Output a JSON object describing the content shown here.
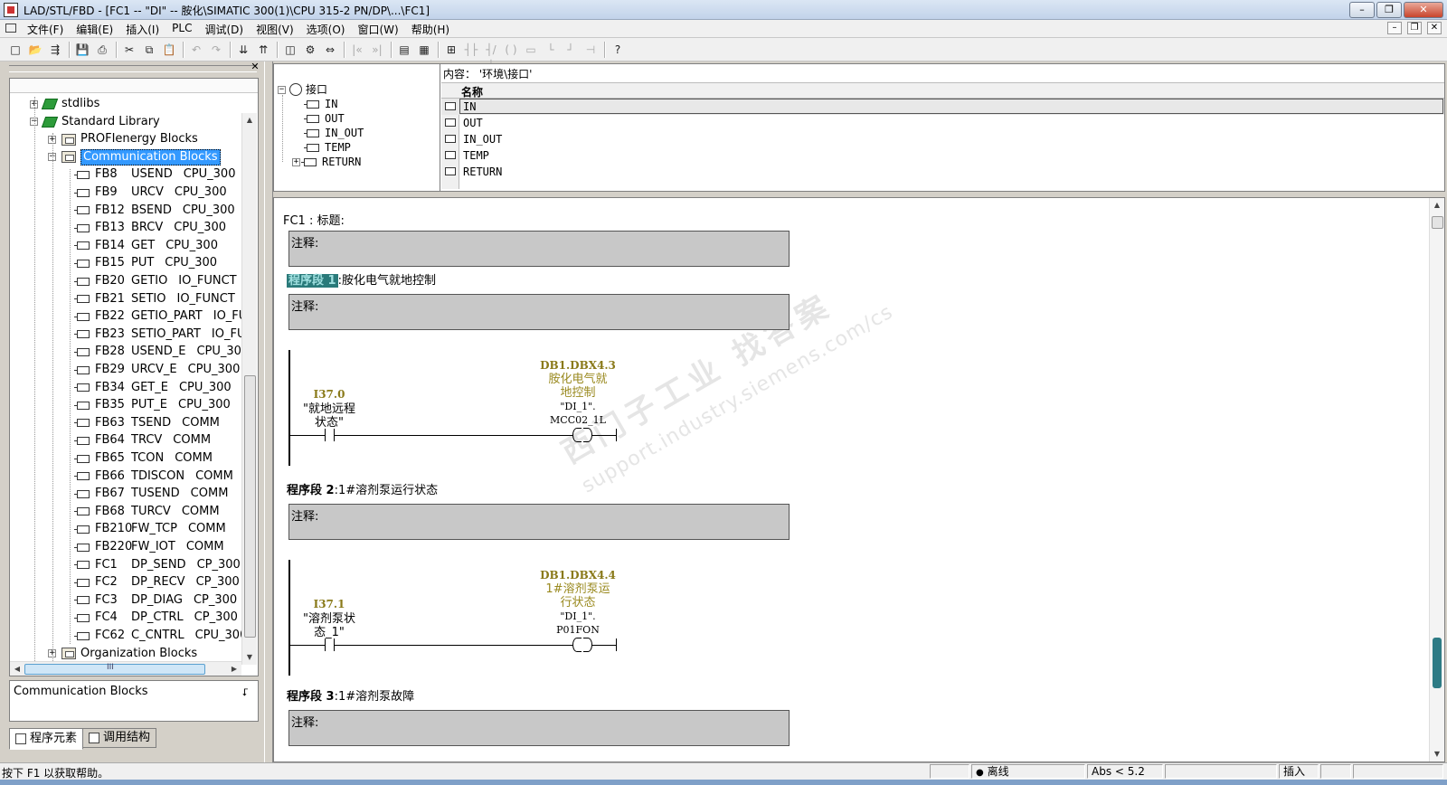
{
  "window": {
    "title": "LAD/STL/FBD  - [FC1 -- \"DI\" -- 胺化\\SIMATIC 300(1)\\CPU 315-2 PN/DP\\...\\FC1]",
    "buttons": {
      "minimize": "–",
      "restore": "❐",
      "close": "✕"
    }
  },
  "menu": {
    "items": [
      "文件(F)",
      "编辑(E)",
      "插入(I)",
      "PLC",
      "调试(D)",
      "视图(V)",
      "选项(O)",
      "窗口(W)",
      "帮助(H)"
    ],
    "mdi": {
      "minimize": "–",
      "restore": "❐",
      "close": "✕"
    }
  },
  "toolbar": {
    "icons": [
      "new-icon",
      "open-icon",
      "accessible-nodes-icon",
      "save-icon",
      "print-icon",
      "cut-icon",
      "copy-icon",
      "paste-icon",
      "undo-icon",
      "redo-icon",
      "download-icon",
      "upload-icon",
      "monitor-icon",
      "settings-icon",
      "compare-icon",
      "prev-icon",
      "next-icon",
      "overview-icon",
      "details-icon",
      "network-icon",
      "contact-no-icon",
      "contact-nc-icon",
      "coil-icon",
      "box-icon",
      "branch-open-icon",
      "branch-close-icon",
      "connect-icon",
      "help-cursor-icon"
    ]
  },
  "library_tree": {
    "nodes": [
      {
        "label": "stdlibs",
        "type": "library",
        "expander": "+"
      },
      {
        "label": "Standard Library",
        "type": "library",
        "expander": "−"
      },
      {
        "label": "PROFIenergy Blocks",
        "type": "folder",
        "expander": "+"
      },
      {
        "label": "Communication Blocks",
        "type": "folder",
        "expander": "−",
        "selected": true
      }
    ],
    "blocks": [
      {
        "id": "FB8",
        "name": "USEND",
        "family": "CPU_300"
      },
      {
        "id": "FB9",
        "name": "URCV",
        "family": "CPU_300"
      },
      {
        "id": "FB12",
        "name": "BSEND",
        "family": "CPU_300"
      },
      {
        "id": "FB13",
        "name": "BRCV",
        "family": "CPU_300"
      },
      {
        "id": "FB14",
        "name": "GET",
        "family": "CPU_300"
      },
      {
        "id": "FB15",
        "name": "PUT",
        "family": "CPU_300"
      },
      {
        "id": "FB20",
        "name": "GETIO",
        "family": "IO_FUNCT"
      },
      {
        "id": "FB21",
        "name": "SETIO",
        "family": "IO_FUNCT"
      },
      {
        "id": "FB22",
        "name": "GETIO_PART",
        "family": "IO_FU"
      },
      {
        "id": "FB23",
        "name": "SETIO_PART",
        "family": "IO_FU"
      },
      {
        "id": "FB28",
        "name": "USEND_E",
        "family": "CPU_300"
      },
      {
        "id": "FB29",
        "name": "URCV_E",
        "family": "CPU_300"
      },
      {
        "id": "FB34",
        "name": "GET_E",
        "family": "CPU_300"
      },
      {
        "id": "FB35",
        "name": "PUT_E",
        "family": "CPU_300"
      },
      {
        "id": "FB63",
        "name": "TSEND",
        "family": "COMM"
      },
      {
        "id": "FB64",
        "name": "TRCV",
        "family": "COMM"
      },
      {
        "id": "FB65",
        "name": "TCON",
        "family": "COMM"
      },
      {
        "id": "FB66",
        "name": "TDISCON",
        "family": "COMM"
      },
      {
        "id": "FB67",
        "name": "TUSEND",
        "family": "COMM"
      },
      {
        "id": "FB68",
        "name": "TURCV",
        "family": "COMM"
      },
      {
        "id": "FB210",
        "name": "FW_TCP",
        "family": "COMM"
      },
      {
        "id": "FB220",
        "name": "FW_IOT",
        "family": "COMM"
      },
      {
        "id": "FC1",
        "name": "DP_SEND",
        "family": "CP_300"
      },
      {
        "id": "FC2",
        "name": "DP_RECV",
        "family": "CP_300"
      },
      {
        "id": "FC3",
        "name": "DP_DIAG",
        "family": "CP_300"
      },
      {
        "id": "FC4",
        "name": "DP_CTRL",
        "family": "CP_300"
      },
      {
        "id": "FC62",
        "name": "C_CNTRL",
        "family": "CPU_300"
      }
    ],
    "trailing": {
      "label": "Organization Blocks",
      "expander": "+"
    },
    "hscroll_glyph": "III"
  },
  "info_box": {
    "text": "Communication Blocks",
    "button": "⮦"
  },
  "left_tabs": [
    {
      "label": "程序元素",
      "active": true
    },
    {
      "label": "调用结构",
      "active": false
    }
  ],
  "interface": {
    "root": "接口",
    "items": [
      {
        "label": "IN",
        "expander": ""
      },
      {
        "label": "OUT",
        "expander": ""
      },
      {
        "label": "IN_OUT",
        "expander": ""
      },
      {
        "label": "TEMP",
        "expander": ""
      },
      {
        "label": "RETURN",
        "expander": "+"
      }
    ],
    "content_label": "内容： '环境\\接口'",
    "column_name": "名称",
    "rows": [
      "IN",
      "OUT",
      "IN_OUT",
      "TEMP",
      "RETURN"
    ]
  },
  "code": {
    "fc_title": "FC1 : 标题:",
    "comment_label": "注释:",
    "networks": [
      {
        "num_label": "程序段 1",
        "title": ":胺化电气就地控制",
        "highlight": true,
        "contact": {
          "address": "I37.0",
          "symbol_lines": [
            "\"就地远程",
            "状态\""
          ]
        },
        "coil": {
          "address": "DB1.DBX4.3",
          "comment_lines": [
            "胺化电气就",
            "地控制"
          ],
          "symbol": "\"DI_1\".",
          "member": "MCC02_1L",
          "glyph": "( )"
        }
      },
      {
        "num_label": "程序段 2",
        "title": ":1#溶剂泵运行状态",
        "highlight": false,
        "contact": {
          "address": "I37.1",
          "symbol_lines": [
            "\"溶剂泵状",
            "态_1\""
          ]
        },
        "coil": {
          "address": "DB1.DBX4.4",
          "comment_lines": [
            "1#溶剂泵运",
            "行状态"
          ],
          "symbol": "\"DI_1\".",
          "member": "P01FON",
          "glyph": "( )"
        }
      },
      {
        "num_label": "程序段 3",
        "title": ":1#溶剂泵故障",
        "highlight": false
      }
    ],
    "watermark": {
      "line1": "西门子工业  找答案",
      "line2": "support.industry.siemens.com/cs"
    }
  },
  "status": {
    "message": "按下 F1 以获取帮助。",
    "mode": "离线",
    "position": "Abs < 5.2",
    "insert": "插入"
  }
}
